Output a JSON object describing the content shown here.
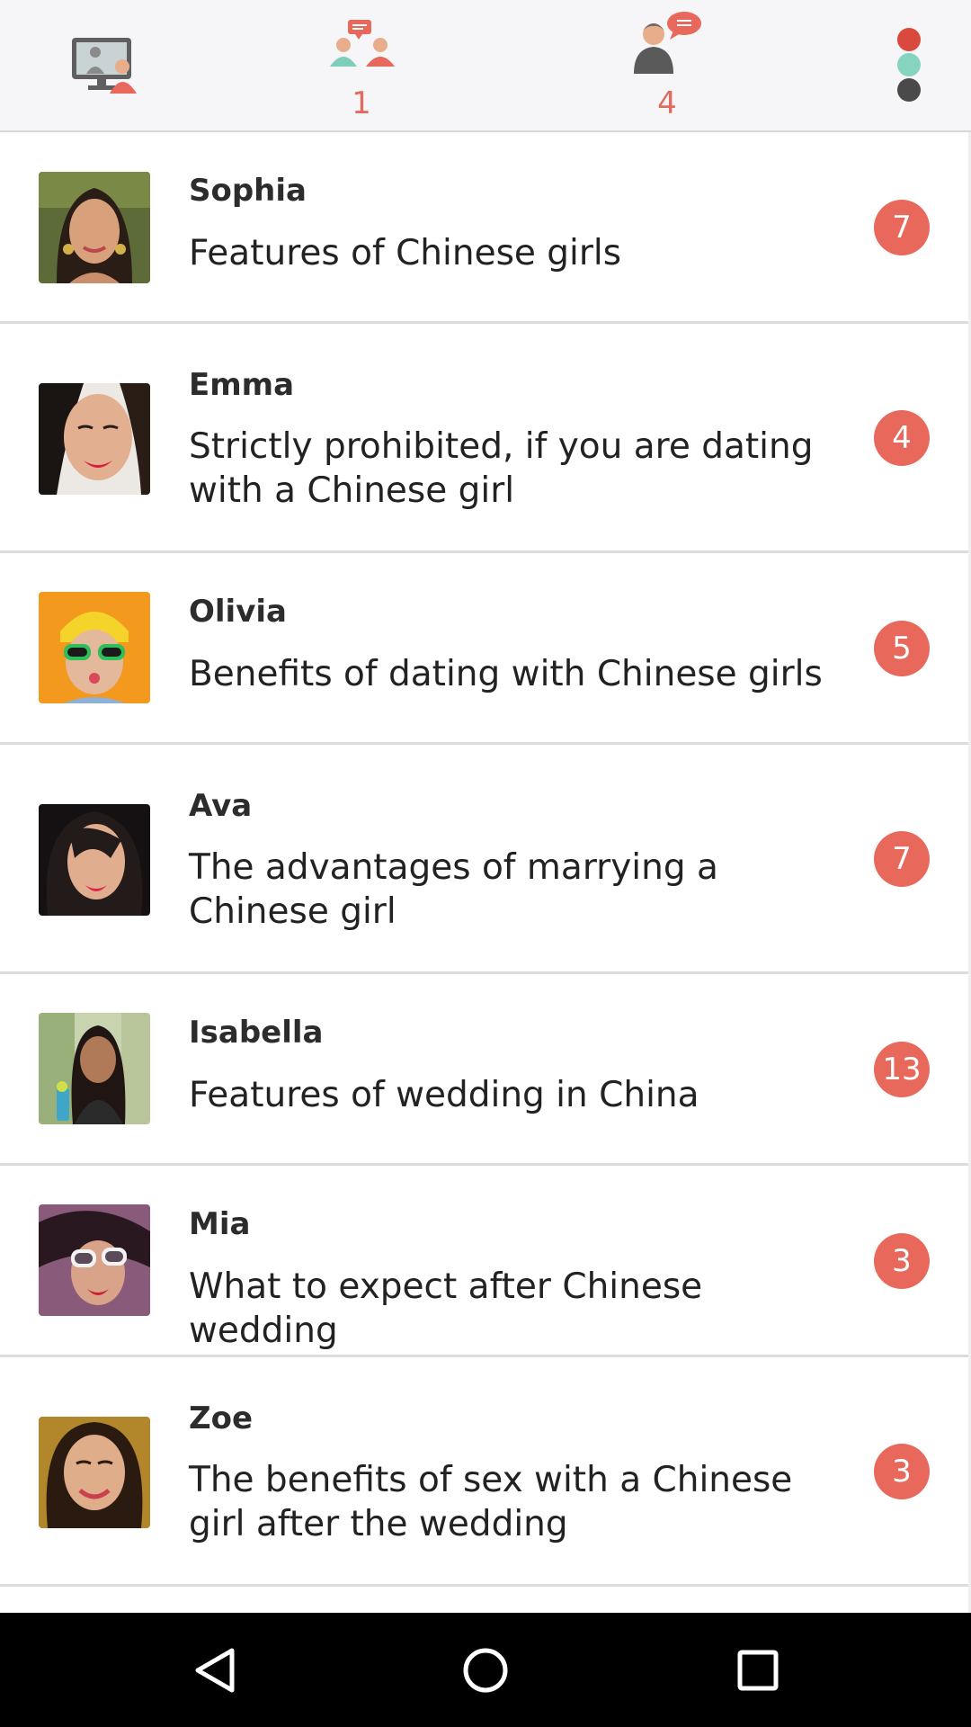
{
  "topbar": {
    "tabs": [
      {
        "id": "video-chat",
        "icon": "video-chat-icon",
        "count": ""
      },
      {
        "id": "conversations",
        "icon": "people-chat-icon",
        "count": "1"
      },
      {
        "id": "messages",
        "icon": "person-message-icon",
        "count": "4"
      }
    ],
    "menu_icon": "overflow-dots-icon"
  },
  "conversations": [
    {
      "name": "Sophia",
      "preview": "Features of Chinese girls",
      "unread": "7"
    },
    {
      "name": "Emma",
      "preview": "Strictly prohibited, if you are dating with a Chinese girl",
      "unread": "4"
    },
    {
      "name": "Olivia",
      "preview": "Benefits of dating with Chinese girls",
      "unread": "5"
    },
    {
      "name": "Ava",
      "preview": "The advantages of marrying a Chinese girl",
      "unread": "7"
    },
    {
      "name": "Isabella",
      "preview": "Features of wedding in China",
      "unread": "13"
    },
    {
      "name": "Mia",
      "preview": "What to expect after Chinese wedding",
      "unread": "3"
    },
    {
      "name": "Zoe",
      "preview": "The benefits of sex with a Chinese girl after the wedding",
      "unread": "3"
    }
  ],
  "navbar": {
    "back": "back-triangle-icon",
    "home": "home-circle-icon",
    "recents": "recents-square-icon"
  },
  "colors": {
    "accent": "#e8695c",
    "count_text": "#e36b5e",
    "teal": "#7fcdbb",
    "dark": "#4a4a4a"
  }
}
